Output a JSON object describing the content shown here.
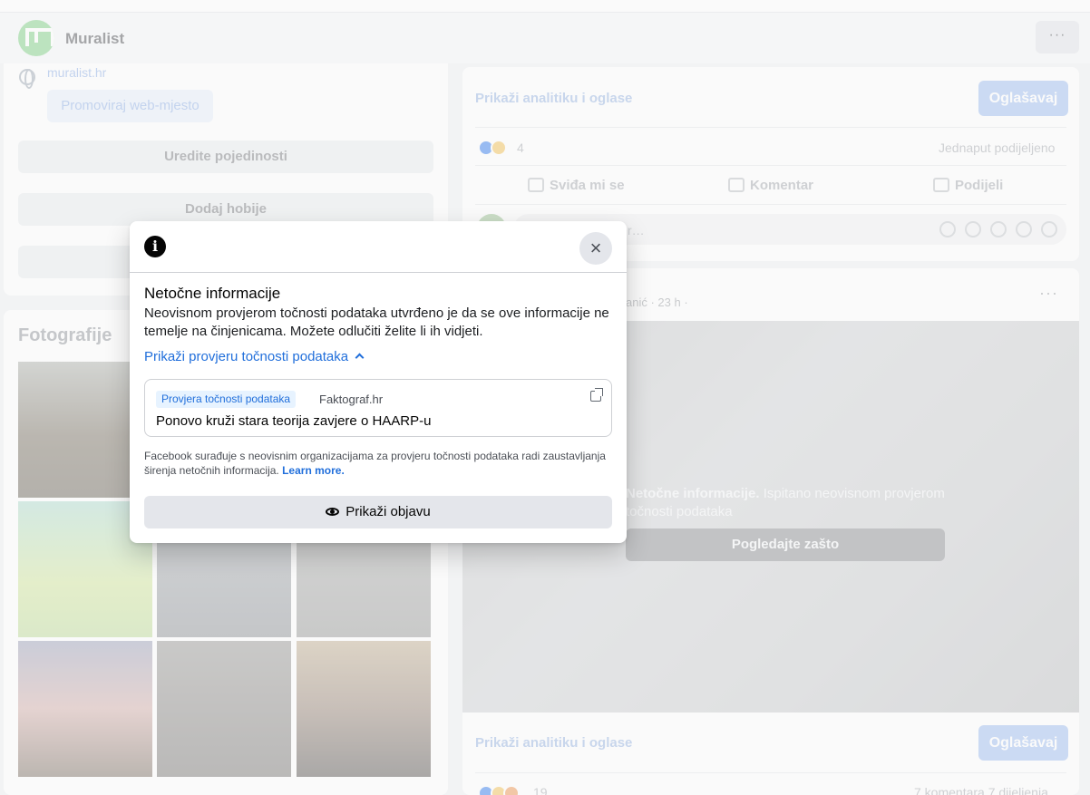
{
  "page": {
    "name": "Muralist",
    "more_label": "···",
    "website": "muralist.hr",
    "promote_website": "Promoviraj web-mjesto",
    "edit_details": "Uredite pojedinosti",
    "add_hobbies": "Dodaj hobije",
    "photos_title": "Fotografije"
  },
  "post1": {
    "analytics_link": "Prikaži analitiku i oglase",
    "advertise": "Oglašavaj",
    "reaction_count": "4",
    "shares": "Jednaput podijeljeno",
    "like": "Sviđa mi se",
    "comment": "Komentar",
    "share": "Podijeli",
    "comment_placeholder": "r…"
  },
  "post2": {
    "meta": "anić · 23 h ·",
    "more_label": "···",
    "overlay_bold": "Netočne informacije.",
    "overlay_text": " Ispitano neovisnom provjerom točnosti podataka",
    "see_why": "Pogledajte zašto",
    "analytics_link": "Prikaži analitiku i oglase",
    "advertise": "Oglašavaj",
    "reaction_count": "19",
    "comments_shares": "7 komentara  7 dijeljenja"
  },
  "modal": {
    "title": "Netočne informacije",
    "description": "Neovisnom provjerom točnosti podataka utvrđeno je da se ove informacije ne temelje na činjenicama. Možete odlučiti želite li ih vidjeti.",
    "toggle": "Prikaži provjeru točnosti podataka",
    "badge": "Provjera točnosti podataka",
    "source": "Faktograf.hr",
    "headline": "Ponovo kruži stara teorija zavjere o HAARP-u",
    "footer": "Facebook surađuje s neovisnim organizacijama za provjeru točnosti podataka radi zaustavljanja širenja netočnih informacija.",
    "learn_more": "Learn more.",
    "show_post": "Prikaži objavu",
    "close_icon": "×",
    "info_icon": "i"
  },
  "colors": {
    "link_blue": "#216fdb",
    "badge_bg": "#e7f3ff",
    "button_gray": "#e4e6eb"
  }
}
